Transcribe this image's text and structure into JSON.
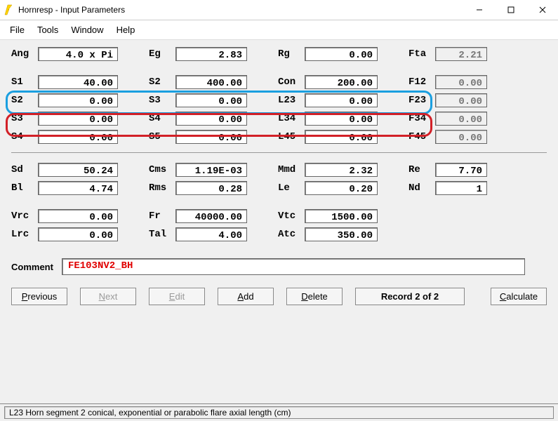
{
  "window": {
    "title": "Hornresp - Input Parameters"
  },
  "menu": {
    "file": "File",
    "tools": "Tools",
    "window": "Window",
    "help": "Help"
  },
  "rows": {
    "ang": {
      "l1": "Ang",
      "v1": "4.0 x Pi",
      "l2": "Eg",
      "v2": "2.83",
      "l3": "Rg",
      "v3": "0.00",
      "l4": "Fta",
      "v4": "2.21"
    },
    "s1": {
      "l1": "S1",
      "v1": "40.00",
      "l2": "S2",
      "v2": "400.00",
      "l3": "Con",
      "v3": "200.00",
      "l4": "F12",
      "v4": "0.00"
    },
    "s2": {
      "l1": "S2",
      "v1": "0.00",
      "l2": "S3",
      "v2": "0.00",
      "l3": "L23",
      "v3": "0.00",
      "l4": "F23",
      "v4": "0.00"
    },
    "s3": {
      "l1": "S3",
      "v1": "0.00",
      "l2": "S4",
      "v2": "0.00",
      "l3": "L34",
      "v3": "0.00",
      "l4": "F34",
      "v4": "0.00"
    },
    "s4": {
      "l1": "S4",
      "v1": "0.00",
      "l2": "S5",
      "v2": "0.00",
      "l3": "L45",
      "v3": "0.00",
      "l4": "F45",
      "v4": "0.00"
    },
    "sd": {
      "l1": "Sd",
      "v1": "50.24",
      "l2": "Cms",
      "v2": "1.19E-03",
      "l3": "Mmd",
      "v3": "2.32",
      "l4": "Re",
      "v4": "7.70"
    },
    "bl": {
      "l1": "Bl",
      "v1": "4.74",
      "l2": "Rms",
      "v2": "0.28",
      "l3": "Le",
      "v3": "0.20",
      "l4": "Nd",
      "v4": "1"
    },
    "vrc": {
      "l1": "Vrc",
      "v1": "0.00",
      "l2": "Fr",
      "v2": "40000.00",
      "l3": "Vtc",
      "v3": "1500.00"
    },
    "lrc": {
      "l1": "Lrc",
      "v1": "0.00",
      "l2": "Tal",
      "v2": "4.00",
      "l3": "Atc",
      "v3": "350.00"
    }
  },
  "comment": {
    "label": "Comment",
    "value": "FE103NV2_BH"
  },
  "buttons": {
    "previous": "Previous",
    "next": "Next",
    "edit": "Edit",
    "add": "Add",
    "delete": "Delete",
    "record": "Record 2 of 2",
    "calculate": "Calculate"
  },
  "status": {
    "text": "L23   Horn segment 2 conical, exponential or parabolic flare axial length  (cm)"
  }
}
